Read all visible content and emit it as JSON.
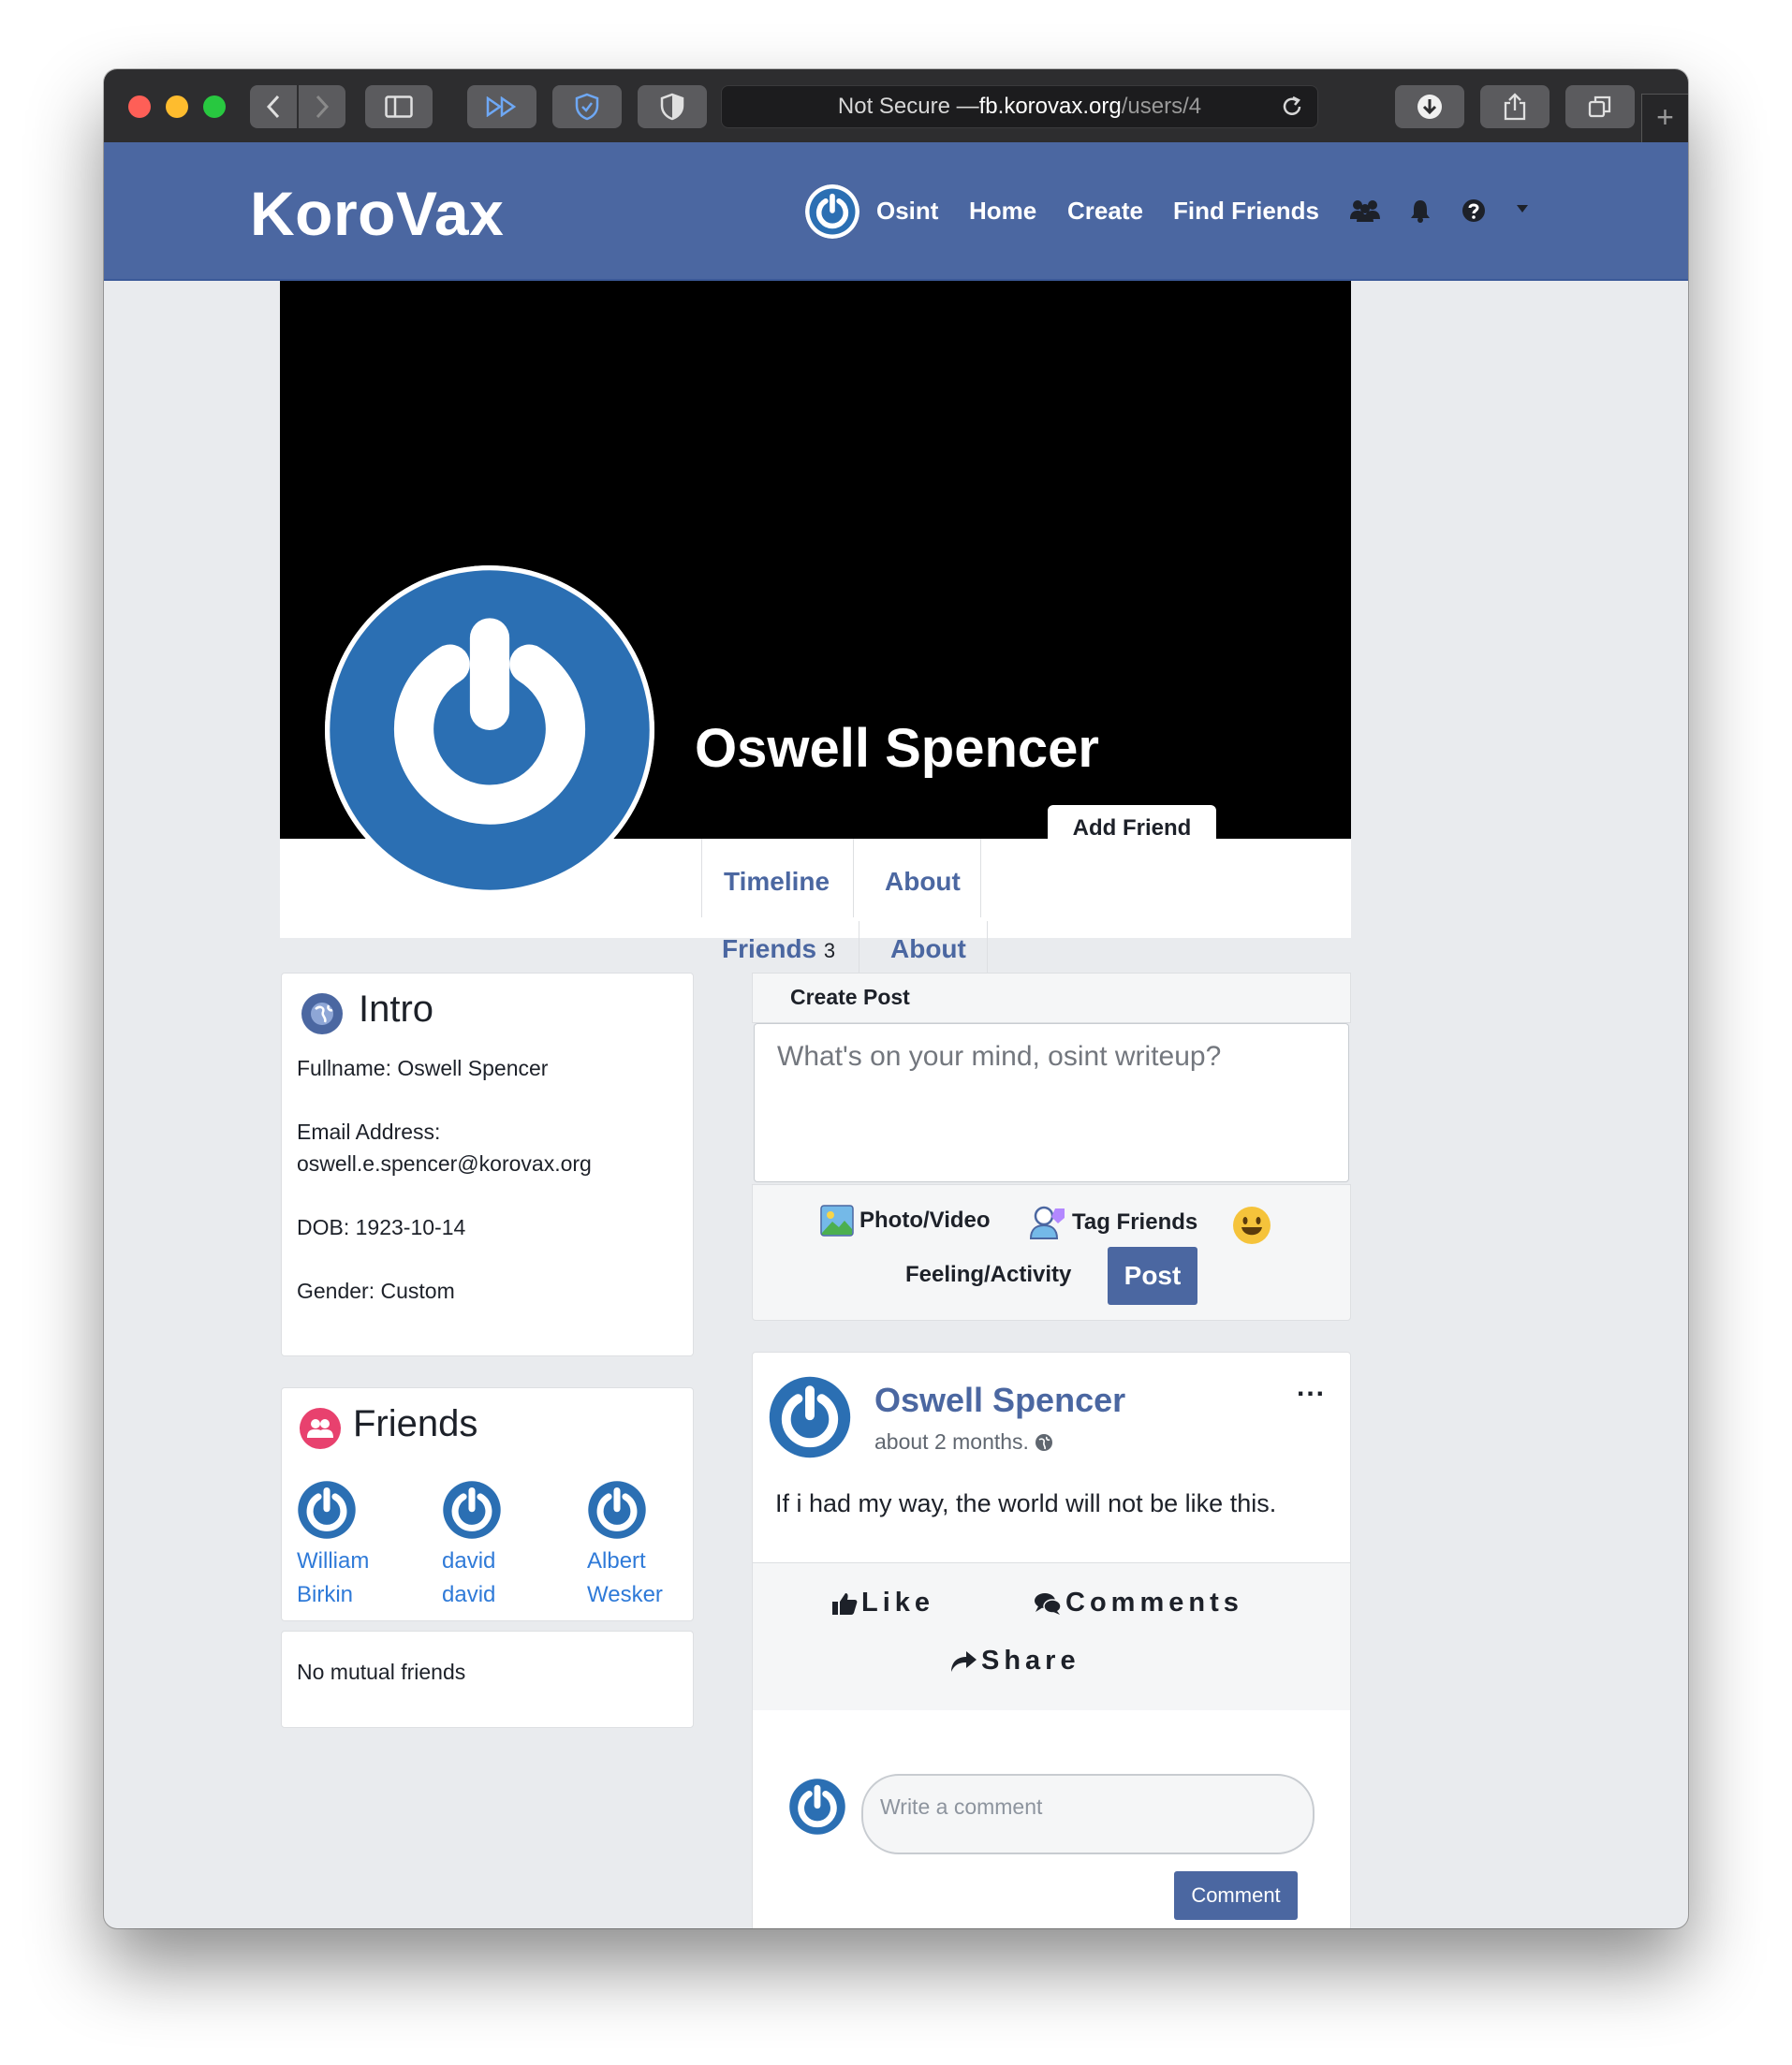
{
  "browser": {
    "address_prefix": "Not Secure — ",
    "address_host": "fb.korovax.org",
    "address_path": "/users/4",
    "new_tab": "+"
  },
  "navbar": {
    "brand": "KoroVax",
    "user_name": "Osint",
    "links": [
      "Home",
      "Create",
      "Find Friends"
    ],
    "icons": [
      "friends-group-icon",
      "bell-icon",
      "help-icon",
      "caret-down-icon"
    ]
  },
  "profile": {
    "name": "Oswell Spencer",
    "add_friend": "Add Friend",
    "tabs": {
      "timeline": "Timeline",
      "about": "About",
      "friends": "Friends",
      "friends_count": "3",
      "about2": "About"
    }
  },
  "intro": {
    "title": "Intro",
    "fullname": "Fullname: Oswell Spencer",
    "email_label": "Email Address:",
    "email": "oswell.e.spencer@korovax.org",
    "dob": "DOB: 1923-10-14",
    "gender": "Gender: Custom"
  },
  "friends": {
    "title": "Friends",
    "items": [
      {
        "first": "William",
        "last": "Birkin"
      },
      {
        "first": "david",
        "last": "david"
      },
      {
        "first": "Albert",
        "last": "Wesker"
      }
    ],
    "mutual": "No mutual friends"
  },
  "create_post": {
    "header": "Create Post",
    "placeholder": "What's on your mind, osint writeup?",
    "photo_video": "Photo/Video",
    "tag_friends": "Tag Friends",
    "feeling": "Feeling/Activity",
    "post_button": "Post"
  },
  "post": {
    "author": "Oswell Spencer",
    "time": "about 2 months.",
    "more": "...",
    "body": "If i had my way, the world will not be like this.",
    "like": "Like",
    "comments": "Comments",
    "share": "Share",
    "comment_placeholder": "Write a comment",
    "comment_button": "Comment"
  },
  "colors": {
    "brand_blue": "#4b67a1",
    "avatar_blue": "#2b6fb3",
    "link_blue": "#2f7ad8",
    "background": "#e9ebee"
  }
}
